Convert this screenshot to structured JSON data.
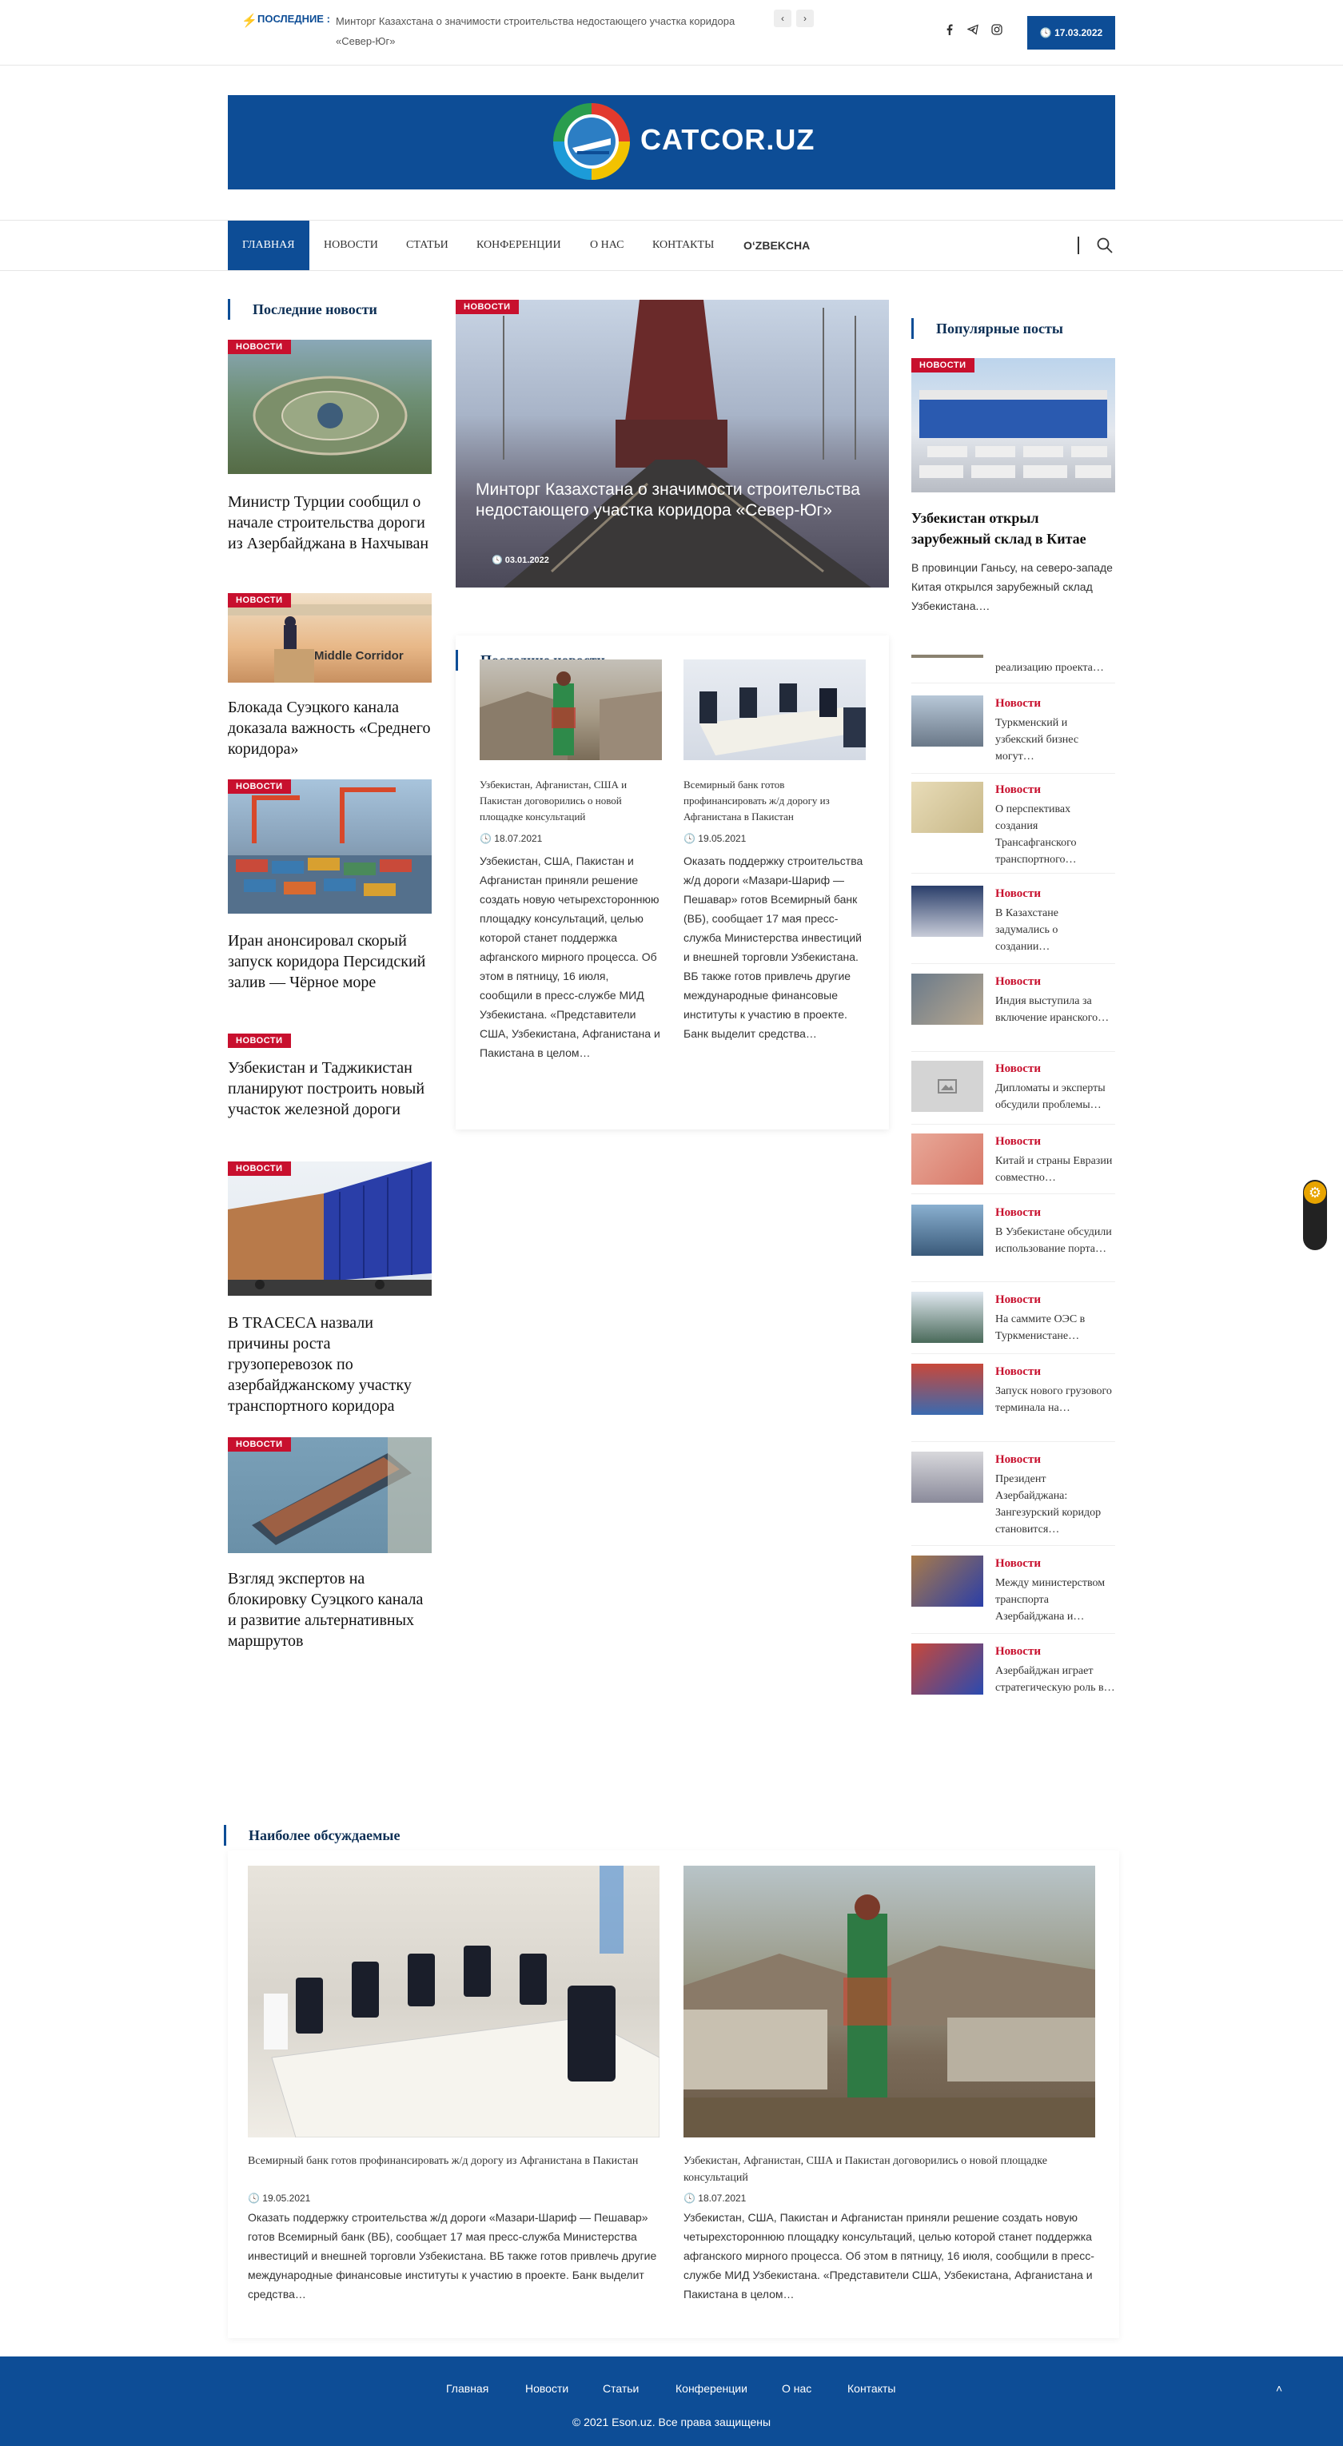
{
  "colors": {
    "brand": "#0d4d96",
    "badge": "#c8102e"
  },
  "topbar": {
    "ticker_icon": "bolt-icon",
    "ticker_label": "ПОСЛЕДНИЕ :",
    "ticker_text": "Минторг Казахстана о значимости строительства недостающего участка коридора «Север-Юг»",
    "prev": "‹",
    "next": "›",
    "social": [
      "facebook-icon",
      "telegram-icon",
      "instagram-icon"
    ],
    "date_icon": "clock-icon",
    "date": "17.03.2022"
  },
  "logo": {
    "text": "CATCOR.UZ"
  },
  "nav": {
    "items": [
      "ГЛАВНАЯ",
      "НОВОСТИ",
      "СТАТЬИ",
      "КОНФЕРЕНЦИИ",
      "О НАС",
      "КОНТАКТЫ",
      "OʻZBEKCHA"
    ],
    "search_icon": "search-icon"
  },
  "left": {
    "section_title": "Последние новости",
    "badge": "НОВОСТИ",
    "articles": [
      "Министр Турции сообщил о начале строительства дороги из Азербайджана в Нахчыван",
      "Блокада Суэцкого канала доказала важность «Среднего коридора»",
      "Иран анонсировал скорый запуск коридора Персидский залив — Чёрное море",
      "Узбекистан и Таджикистан планируют построить новый участок железной дороги",
      "В TRACECA назвали причины роста грузоперевозок по азербайджанскому участку транспортного коридора",
      "Взгляд экспертов на блокировку Суэцкого канала и развитие альтернативных маршрутов"
    ],
    "banner_text": "Middle Corridor"
  },
  "center": {
    "hero": {
      "badge": "НОВОСТИ",
      "title": "Минторг Казахстана о значимости строительства недостающего участка коридора «Север-Юг»",
      "date": "03.01.2022"
    },
    "section_title": "Последние новости",
    "cards": [
      {
        "title": "Узбекистан, Афганистан, США и Пакистан договорились о новой площадке консультаций",
        "date": "18.07.2021",
        "text": "Узбекистан, США, Пакистан и Афганистан приняли решение создать новую четырехстороннюю площадку консультаций, целью которой станет поддержка афганского мирного процесса. Об этом в пятницу, 16 июля, сообщили в пресс-службе МИД Узбекистана. «Представители США, Узбекистана, Афганистана и Пакистана в целом…"
      },
      {
        "title": "Всемирный банк готов профинансировать ж/д дорогу из Афганистана в Пакистан",
        "date": "19.05.2021",
        "text": "Оказать поддержку строительства ж/д дороги «Мазари-Шариф — Пешавар» готов Всемирный банк (ВБ), сообщает 17 мая пресс-служба Министерства инвестиций и внешней торговли Узбекистана. ВБ также готов привлечь другие международные финансовые институты к участию в проекте. Банк выделит средства…"
      }
    ]
  },
  "right": {
    "section_title": "Популярные посты",
    "featured": {
      "badge": "НОВОСТИ",
      "title": "Узбекистан открыл зарубежный склад в Китае",
      "text": "В провинции Ганьсу, на северо-западе Китая открылся зарубежный склад Узбекистана.…"
    },
    "partial_text": "реализацию проекта…",
    "category": "Новости",
    "items": [
      "Туркменский и узбекский бизнес могут…",
      "О перспективах создания Трансафганского транспортного…",
      "В Казахстане задумались о создании…",
      "Индия выступила за включение иранского…",
      "Дипломаты и эксперты обсудили проблемы…",
      "Китай и страны Евразии совместно…",
      "В Узбекистане обсудили использование порта…",
      "На саммите ОЭС в Туркменистане…",
      "Запуск нового грузового терминала на…",
      "Президент Азербайджана: Зангезурский коридор становится…",
      "Между министерством транспорта Азербайджана и…",
      "Азербайджан играет стратегическую роль в…"
    ]
  },
  "bottom": {
    "section_title": "Наиболее обсуждаемые",
    "cards": [
      {
        "title": "Всемирный банк готов профинансировать ж/д дорогу из Афганистана в Пакистан",
        "date": "19.05.2021",
        "text": "Оказать поддержку строительства ж/д дороги «Мазари-Шариф — Пешавар» готов Всемирный банк (ВБ), сообщает 17 мая пресс-служба Министерства инвестиций и внешней торговли Узбекистана. ВБ также готов привлечь другие международные финансовые институты к участию в проекте. Банк выделит средства…"
      },
      {
        "title": "Узбекистан, Афганистан, США и Пакистан договорились о новой площадке консультаций",
        "date": "18.07.2021",
        "text": "Узбекистан, США, Пакистан и Афганистан приняли решение создать новую четырехстороннюю площадку консультаций, целью которой станет поддержка афганского мирного процесса. Об этом в пятницу, 16 июля, сообщили в пресс-службе МИД Узбекистана. «Представители США, Узбекистана, Афганистана и Пакистана в целом…"
      }
    ]
  },
  "footer": {
    "links": [
      "Главная",
      "Новости",
      "Статьи",
      "Конференции",
      "О нас",
      "Контакты"
    ],
    "copyright": "© 2021 Eson.uz. Все права защищены",
    "to_top": "˄"
  }
}
